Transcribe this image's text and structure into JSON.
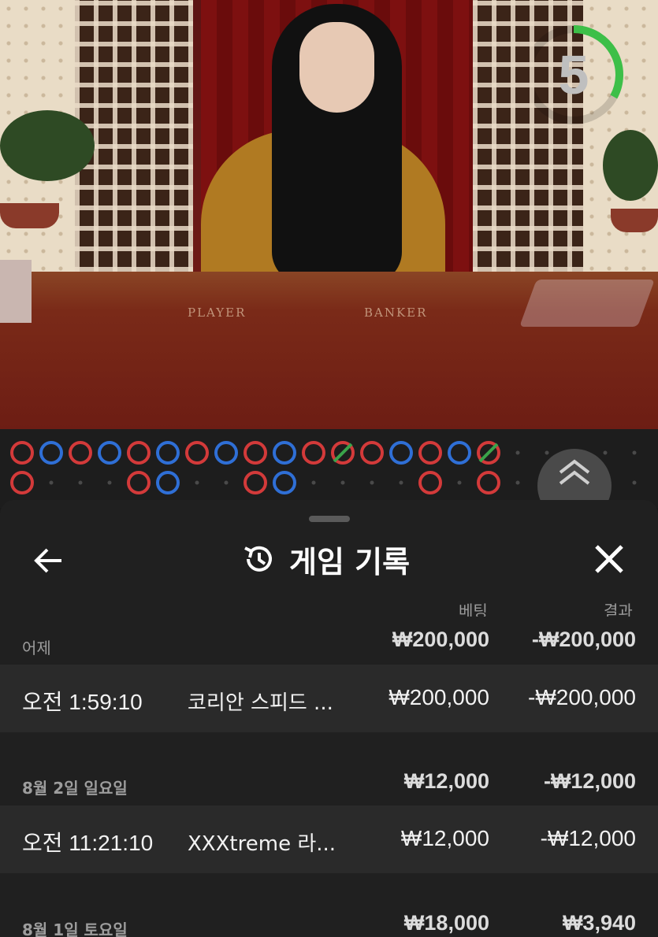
{
  "video": {
    "table_labels": {
      "player": "PLAYER",
      "banker": "BANKER"
    },
    "countdown": {
      "value": "5",
      "fraction_remaining": 0.33,
      "color": "#3dbf48"
    }
  },
  "roadmap": {
    "colors": {
      "P": "#2f6fd6",
      "B": "#d33a3a",
      "T": "#3aa34a"
    },
    "columns": [
      [
        "B",
        "B"
      ],
      [
        "P"
      ],
      [
        "B"
      ],
      [
        "P"
      ],
      [
        "B",
        "B"
      ],
      [
        "P",
        "P"
      ],
      [
        "B"
      ],
      [
        "P"
      ],
      [
        "B",
        "B"
      ],
      [
        "P",
        "P"
      ],
      [
        "B"
      ],
      [
        "T"
      ],
      [
        "B"
      ],
      [
        "P"
      ],
      [
        "B",
        "B"
      ],
      [
        "P"
      ],
      [
        "T",
        "B"
      ]
    ]
  },
  "history": {
    "title": "게임 기록",
    "back_icon": "arrow-left-icon",
    "title_icon": "history-icon",
    "close_icon": "close-icon",
    "col_bet": "베팅",
    "col_result": "결과",
    "groups": [
      {
        "date": "어제",
        "bet_total": "₩200,000",
        "result_total": "-₩200,000",
        "rows": [
          {
            "time": "오전 1:59:10",
            "game": "코리안 스피드 ...",
            "bet": "₩200,000",
            "result": "-₩200,000"
          }
        ]
      },
      {
        "date": "8월 2일 일요일",
        "bet_total": "₩12,000",
        "result_total": "-₩12,000",
        "rows": [
          {
            "time": "오전 11:21:10",
            "game": "XXXtreme 라...",
            "bet": "₩12,000",
            "result": "-₩12,000"
          }
        ]
      },
      {
        "date": "8월 1일 토요일",
        "bet_total": "₩18,000",
        "result_total": "₩3,940",
        "rows": []
      }
    ]
  }
}
